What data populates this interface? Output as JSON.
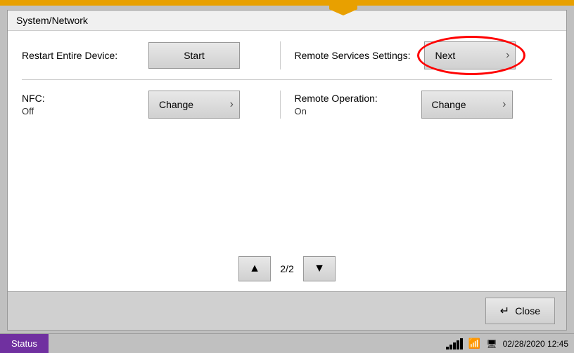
{
  "top_indicator": {},
  "window": {
    "title": "System/Network"
  },
  "rows": [
    {
      "left": {
        "label": "Restart Entire Device:",
        "sub_label": "",
        "button_text": "Start",
        "button_type": "start",
        "show_arrow": false
      },
      "right": {
        "label": "Remote Services Settings:",
        "sub_label": "",
        "button_text": "Next",
        "button_type": "next",
        "show_arrow": true
      }
    },
    {
      "left": {
        "label": "NFC:",
        "sub_label": "Off",
        "button_text": "Change",
        "button_type": "change",
        "show_arrow": true
      },
      "right": {
        "label": "Remote Operation:",
        "sub_label": "On",
        "button_text": "Change",
        "button_type": "change",
        "show_arrow": true
      }
    }
  ],
  "pagination": {
    "up_label": "▲",
    "down_label": "▼",
    "page_text": "2/2"
  },
  "footer": {
    "close_label": "Close"
  },
  "status_bar": {
    "status_label": "Status",
    "datetime": "02/28/2020  12:45"
  }
}
